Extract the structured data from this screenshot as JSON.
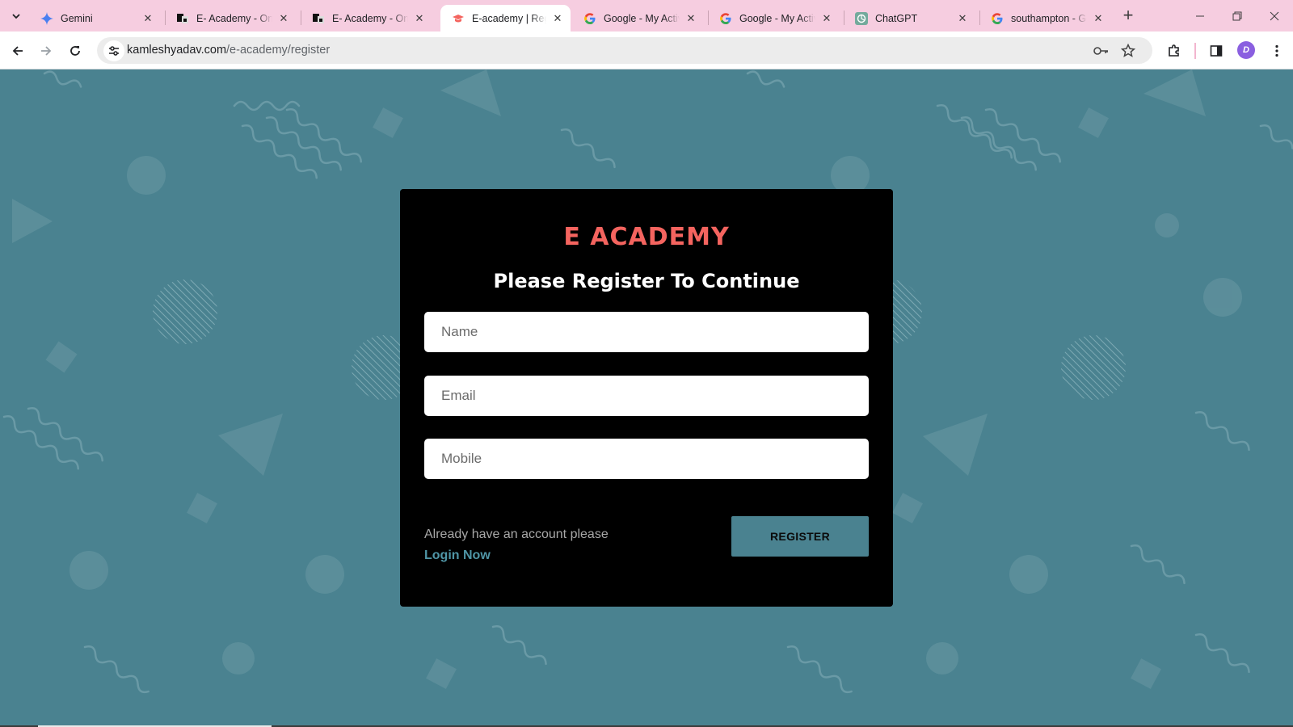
{
  "browser": {
    "tabs": [
      {
        "title": "Gemini",
        "favicon": "gemini-sparkle-icon",
        "active": false
      },
      {
        "title": "E- Academy - Onli",
        "favicon": "e-academy-logo-icon",
        "active": false
      },
      {
        "title": "E- Academy - Onli",
        "favicon": "e-academy-logo-icon",
        "active": false
      },
      {
        "title": "E-academy | Regis",
        "favicon": "graduation-cap-icon",
        "active": true
      },
      {
        "title": "Google - My Activ",
        "favicon": "google-g-icon",
        "active": false
      },
      {
        "title": "Google - My Activ",
        "favicon": "google-g-icon",
        "active": false
      },
      {
        "title": "ChatGPT",
        "favicon": "chatgpt-icon",
        "active": false
      },
      {
        "title": "southampton - Go",
        "favicon": "google-g-icon",
        "active": false
      }
    ],
    "address": {
      "domain": "kamleshyadav.com",
      "path": "/e-academy/register"
    },
    "avatar_letter": "D"
  },
  "page": {
    "brand": "E ACADEMY",
    "subtitle": "Please Register To Continue",
    "fields": {
      "name_placeholder": "Name",
      "email_placeholder": "Email",
      "mobile_placeholder": "Mobile"
    },
    "footer_text": "Already have an account please",
    "login_link": "Login Now",
    "register_button": "REGISTER"
  },
  "colors": {
    "background": "#4a8290",
    "card": "#000000",
    "brand": "#f4645f",
    "link": "#4f95a6",
    "tab_strip": "#f6cde0"
  }
}
